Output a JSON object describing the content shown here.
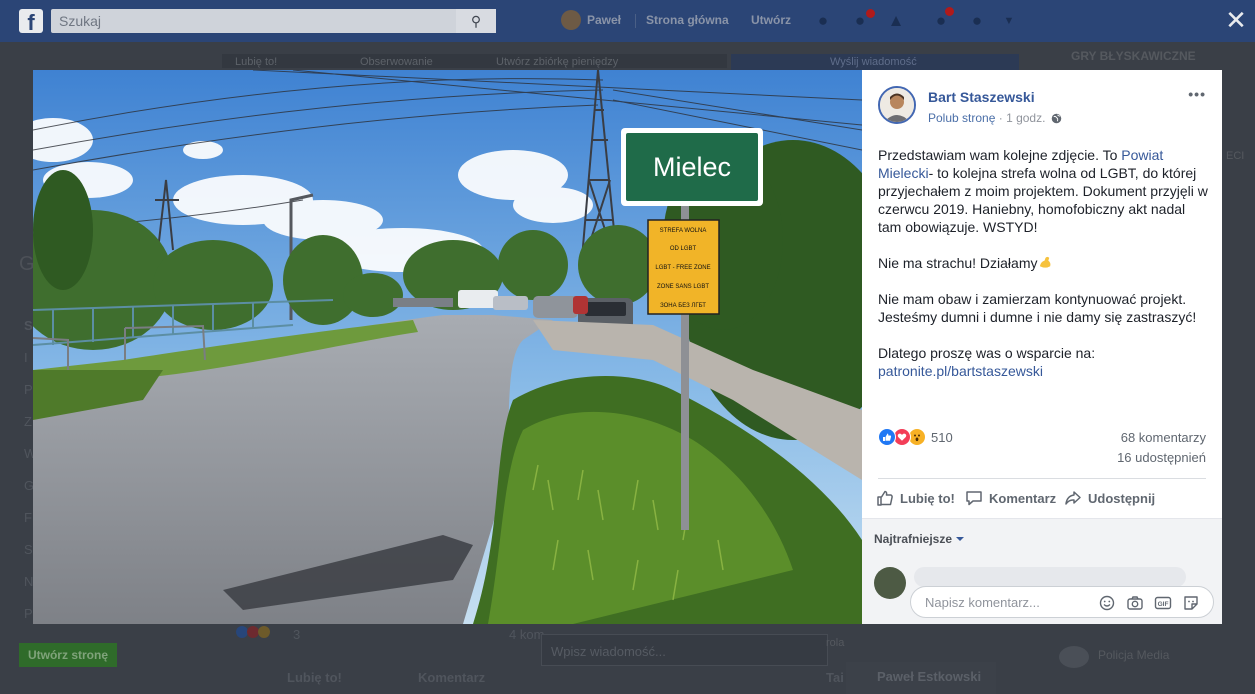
{
  "topbar": {
    "search_placeholder": "Szukaj",
    "user_short": "Paweł",
    "home": "Strona główna",
    "create": "Utwórz"
  },
  "background": {
    "left_letters": [
      "G",
      "S",
      "I",
      "P",
      "Z",
      "W",
      "G",
      "F",
      "S",
      "N",
      "P"
    ],
    "tabs": [
      "Lubię to!",
      "Obserwowanie",
      "Utwórz zbiórkę pieniędzy"
    ],
    "send_message": "Wyślij wiadomość",
    "games_header": "GRY BŁYSKAWICZNE",
    "right_header_cut": "ECI",
    "bottom_reaction_count": "3",
    "bottom_comments_cut": "4 kom",
    "message_placeholder": "Wpisz wiadomość...",
    "like": "Lubię to!",
    "comment": "Komentarz",
    "create_page": "Utwórz stronę",
    "chat_name": "Paweł Estkowski",
    "police": "Policja Media",
    "cut_text": "rola",
    "cut_text2": "Tai"
  },
  "photo": {
    "town_sign": "Mielec",
    "zone_sign_lines": [
      "STREFA WOLNA",
      "OD LGBT",
      "LGBT - FREE ZONE",
      "ZONE SANS LGBT",
      "ЗОНА БЕЗ ЛГБТ"
    ]
  },
  "post": {
    "author": "Bart Staszewski",
    "like_page": "Polub stronę",
    "separator": "·",
    "time": "1 godz.",
    "p1_pre": "Przedstawiam wam kolejne zdjęcie. To ",
    "p1_link": "Powiat Mielecki",
    "p1_post": "- to kolejna strefa wolna od LGBT, do której przyjechałem z moim projektem. Dokument przyjęli w czerwcu 2019. Haniebny, homofobiczny akt nadal tam obowiązuje. WSTYD!",
    "p2": "Nie ma strachu! Działamy",
    "p3": "Nie mam obaw i zamierzam kontynuować projekt. Jesteśmy dumni i dumne i nie damy się zastraszyć!",
    "p4_pre": "Dlatego proszę was o wsparcie na: ",
    "p4_link": "patronite.pl/bartstaszewski",
    "reaction_count": "510",
    "comments": "68 komentarzy",
    "shares": "16 udostępnień",
    "like_label": "Lubię to!",
    "comment_label": "Komentarz",
    "share_label": "Udostępnij",
    "sort_label": "Najtrafniejsze",
    "compose_placeholder": "Napisz komentarz...",
    "gif_label": "GIF"
  },
  "colors": {
    "fb_blue": "#4267b2",
    "link": "#365899",
    "like": "#2078f4",
    "love": "#f33e58",
    "wow": "#f7b125"
  },
  "icons": [
    "facebook-logo-icon",
    "search-icon",
    "friends-icon",
    "messenger-icon",
    "notifications-icon",
    "help-icon",
    "close-icon",
    "globe-icon",
    "more-icon",
    "like-icon",
    "comment-icon",
    "share-icon",
    "emoji-icon",
    "camera-icon",
    "gif-icon",
    "sticker-icon"
  ]
}
